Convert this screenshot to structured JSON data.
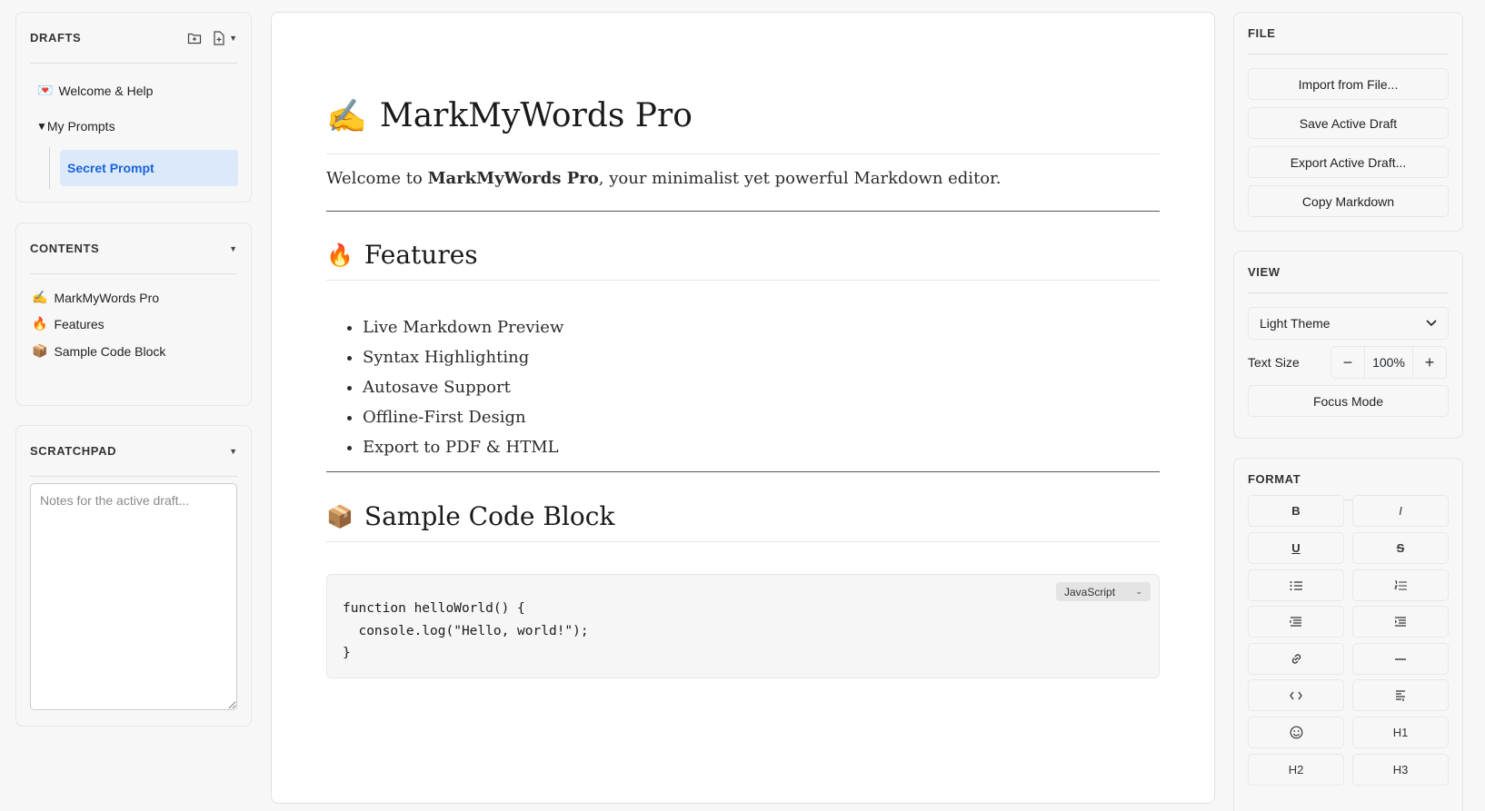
{
  "drafts": {
    "title": "DRAFTS",
    "items": [
      {
        "icon": "💌",
        "label": "Welcome & Help"
      },
      {
        "icon": "▼",
        "label": "My Prompts"
      }
    ],
    "selected": "Secret Prompt"
  },
  "contents": {
    "title": "CONTENTS",
    "items": [
      {
        "icon": "✍️",
        "label": "MarkMyWords Pro"
      },
      {
        "icon": "🔥",
        "label": "Features"
      },
      {
        "icon": "📦",
        "label": "Sample Code Block"
      }
    ]
  },
  "scratchpad": {
    "title": "SCRATCHPAD",
    "placeholder": "Notes for the active draft..."
  },
  "document": {
    "h1_icon": "✍️",
    "h1": "MarkMyWords Pro",
    "intro_prefix": "Welcome to ",
    "intro_bold": "MarkMyWords Pro",
    "intro_suffix": ", your minimalist yet powerful Markdown editor.",
    "features_icon": "🔥",
    "features_title": "Features",
    "features": [
      "Live Markdown Preview",
      "Syntax Highlighting",
      "Autosave Support",
      "Offline-First Design",
      "Export to PDF & HTML"
    ],
    "code_icon": "📦",
    "code_title": "Sample Code Block",
    "code_language": "JavaScript",
    "code": "function helloWorld() {\n  console.log(\"Hello, world!\");\n}"
  },
  "file": {
    "title": "FILE",
    "buttons": [
      "Import from File...",
      "Save Active Draft",
      "Export Active Draft...",
      "Copy Markdown"
    ]
  },
  "view": {
    "title": "VIEW",
    "theme": "Light Theme",
    "text_size_label": "Text Size",
    "text_size_value": "100%",
    "minus": "−",
    "plus": "+",
    "focus_mode": "Focus Mode"
  },
  "format": {
    "title": "FORMAT",
    "bold": "B",
    "italic": "I",
    "underline": "U",
    "strike": "S",
    "h1": "H1",
    "h2": "H2",
    "h3": "H3"
  },
  "colors": {
    "accent": "#1a63d8",
    "selected_bg": "#dce9fb",
    "panel_bg": "#f7f7f7"
  }
}
